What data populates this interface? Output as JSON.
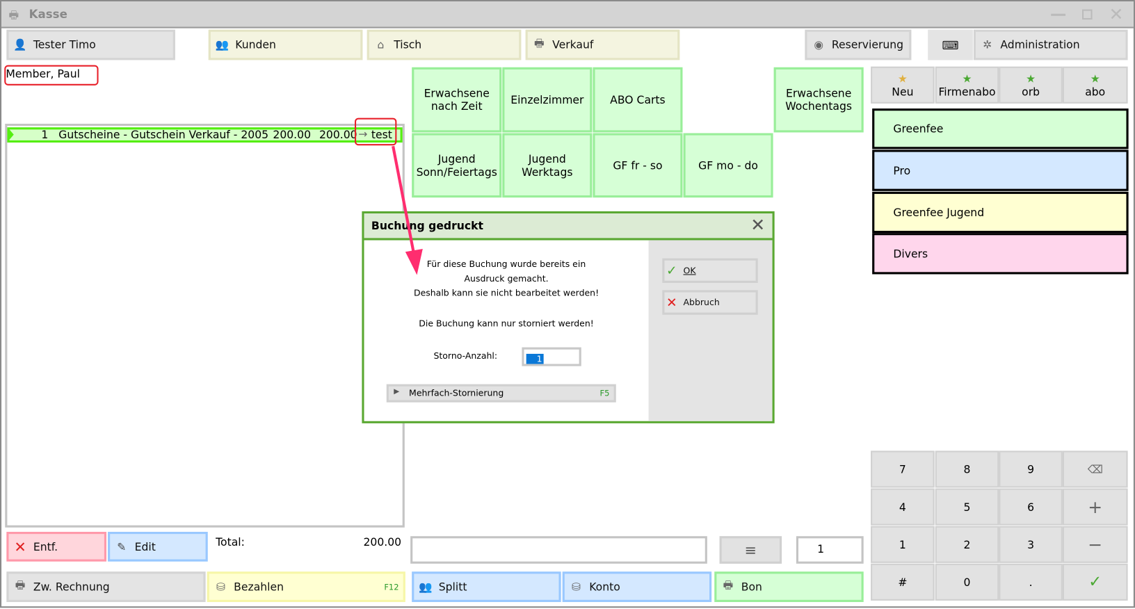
{
  "window": {
    "title": "Kasse"
  },
  "topbar": {
    "user": "Tester Timo",
    "kunden": "Kunden",
    "tisch": "Tisch",
    "verkauf": "Verkauf",
    "reservierung": "Reservierung",
    "administration": "Administration"
  },
  "customer": "Member, Paul",
  "order_items": [
    {
      "qty": "1",
      "name": "Gutscheine - Gutschein Verkauf - 2005",
      "price": "200.00",
      "total": "200.00",
      "note": "test"
    }
  ],
  "products": {
    "row1": [
      "Erwachsene nach Zeit",
      "Einzelzimmer",
      "ABO Carts",
      "Erwachsene Wochentags"
    ],
    "row2": [
      "Jugend Sonn/Feiertags",
      "Jugend Werktags",
      "GF fr - so",
      "GF mo - do"
    ]
  },
  "favorites": [
    "Neu",
    "Firmenabo",
    "orb",
    "abo"
  ],
  "categories": [
    "Greenfee",
    "Pro",
    "Greenfee Jugend",
    "Divers"
  ],
  "numpad": [
    "7",
    "8",
    "9",
    "4",
    "5",
    "6",
    "1",
    "2",
    "3",
    "#",
    "0",
    "."
  ],
  "bottom": {
    "entf": "Entf.",
    "edit": "Edit",
    "total_label": "Total:",
    "total_value": "200.00",
    "quantity": "1",
    "zw_rechnung": "Zw. Rechnung",
    "bezahlen": "Bezahlen",
    "bezahlen_key": "F12",
    "splitt": "Splitt",
    "konto": "Konto",
    "bon": "Bon"
  },
  "dialog": {
    "title": "Buchung gedruckt",
    "line1": "Für diese Buchung wurde bereits ein",
    "line2": "Ausdruck gemacht.",
    "line3": "Deshalb kann sie nicht bearbeitet werden!",
    "line4": "Die Buchung kann nur storniert werden!",
    "storno_label": "Storno-Anzahl:",
    "storno_value": "1",
    "ok": "OK",
    "abbruch": "Abbruch",
    "mehrfach": "Mehrfach-Stornierung",
    "mehrfach_key": "F5"
  },
  "colors": {
    "accent_green": "#5aa832",
    "annotation": "#ff2d6f"
  }
}
